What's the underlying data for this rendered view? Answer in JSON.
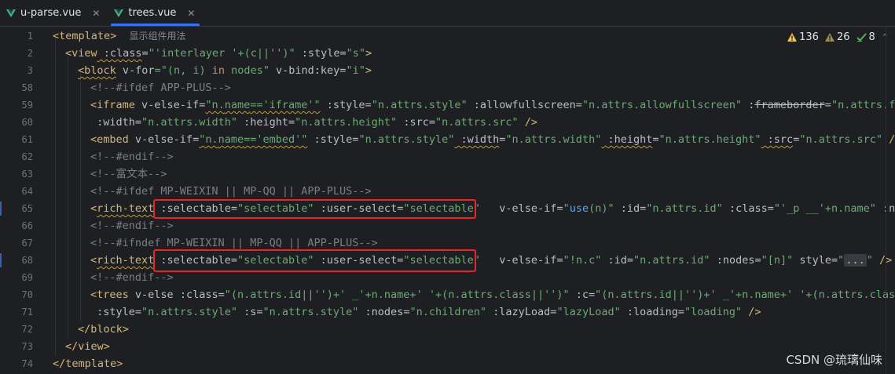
{
  "tabs": [
    {
      "label": "u-parse.vue",
      "active": false
    },
    {
      "label": "trees.vue",
      "active": true
    }
  ],
  "inspections": {
    "warnings": "136",
    "weak_warnings": "26",
    "ok": "8"
  },
  "inlay_hint": "显示组件用法",
  "line_numbers": [
    "1",
    "2",
    "3",
    "58",
    "59",
    "60",
    "61",
    "62",
    "63",
    "64",
    "65",
    "66",
    "67",
    "68",
    "69",
    "70",
    "71",
    "72",
    "73",
    "74"
  ],
  "code": {
    "l1_tag": "<template>",
    "l2_a": "<view",
    "l2_b": " :class",
    "l2_c": "=",
    "l2_d": "\"'interlayer '+(c||'')\"",
    "l2_e": " :style",
    "l2_f": "=",
    "l2_g": "\"s\"",
    "l2_h": ">",
    "l3_a": "<block",
    "l3_b": " v-for",
    "l3_c": "=\"(n, i) ",
    "l3_d": "in",
    "l3_e": " nodes\"",
    "l3_f": " v-bind:key",
    "l3_g": "=",
    "l3_h": "\"i\"",
    "l3_i": ">",
    "l58": "<!--#ifdef APP-PLUS-->",
    "l59_a": "<iframe",
    "l59_b": " v-else-if",
    "l59_c": "=",
    "l59_d": "\"n.",
    "l59_e": "name",
    "l59_f": "=='iframe'\"",
    "l59_g": " :style",
    "l59_h": "=",
    "l59_i": "\"n.attrs.style\"",
    "l59_j": " :allowfullscreen",
    "l59_k": "=",
    "l59_l": "\"n.attrs.allowfullscreen\"",
    "l59_m": " :",
    "l59_n": "frameborder",
    "l59_o": "=",
    "l59_p": "\"n.attrs.fra",
    "l60_a": " :width",
    "l60_b": "=",
    "l60_c": "\"n.attrs.width\"",
    "l60_d": " :height",
    "l60_e": "=",
    "l60_f": "\"n.attrs.height\"",
    "l60_g": " :src",
    "l60_h": "=",
    "l60_i": "\"n.attrs.src\"",
    "l60_j": " />",
    "l61_a": "<embed",
    "l61_b": " v-else-if",
    "l61_c": "=",
    "l61_d": "\"n.",
    "l61_e": "name",
    "l61_f": "=='embed'\"",
    "l61_g": " :style",
    "l61_h": "=",
    "l61_i": "\"n.attrs.style\"",
    "l61_j": " :width",
    "l61_k": "=",
    "l61_l": "\"n.attrs.width\"",
    "l61_m": " :height",
    "l61_n": "=",
    "l61_o": "\"n.attrs.height\"",
    "l61_p": " :src",
    "l61_q": "=",
    "l61_r": "\"n.attrs.src\"",
    "l61_s": " />",
    "l62": "<!--#endif-->",
    "l63": "<!--富文本-->",
    "l64": "<!--#ifdef MP-WEIXIN || MP-QQ || APP-PLUS-->",
    "l65_a": "<",
    "l65_b": "rich-text",
    "l65_c": " :selectable",
    "l65_d": "=",
    "l65_e": "\"selectable\"",
    "l65_f": " :user-select",
    "l65_g": "=",
    "l65_h": "\"selectable\"",
    "l65_i": " v-else-if",
    "l65_j": "=",
    "l65_k": "\"",
    "l65_l": "use",
    "l65_m": "(n)\"",
    "l65_n": " :id",
    "l65_o": "=",
    "l65_p": "\"n.attrs.id\"",
    "l65_q": " :class",
    "l65_r": "=",
    "l65_s": "\"'_p __'+n.name\"",
    "l65_t": " :nodes",
    "l66": "<!--#endif-->",
    "l67": "<!--#ifndef MP-WEIXIN || MP-QQ || APP-PLUS-->",
    "l68_a": "<",
    "l68_b": "rich-text",
    "l68_c": " :selectable",
    "l68_d": "=",
    "l68_e": "\"selectable\"",
    "l68_f": " :user-select",
    "l68_g": "=",
    "l68_h": "\"selectable\"",
    "l68_i": " v-else-if",
    "l68_j": "=",
    "l68_k": "\"!n.c\"",
    "l68_l": " :id",
    "l68_m": "=",
    "l68_n": "\"n.attrs.id\"",
    "l68_o": " :nodes",
    "l68_p": "=",
    "l68_q": "\"[n]\"",
    "l68_r": " style",
    "l68_s": "=",
    "l68_t": "\"",
    "l68_u": "...",
    "l68_v": "\"",
    "l68_w": " />",
    "l69": "<!--#endif-->",
    "l70_a": "<trees",
    "l70_b": " v-else",
    "l70_c": " :class",
    "l70_d": "=",
    "l70_e": "\"(n.attrs.id||'')+' _'+n.name+' '+(n.attrs.class||'')\"",
    "l70_f": " :c",
    "l70_g": "=",
    "l70_h": "\"(n.attrs.id||'')+' _'+n.name+' '+(n.attrs.class|",
    "l71_a": " :style",
    "l71_b": "=",
    "l71_c": "\"n.attrs.style\"",
    "l71_d": " :s",
    "l71_e": "=",
    "l71_f": "\"n.attrs.style\"",
    "l71_g": " :nodes",
    "l71_h": "=",
    "l71_i": "\"n.children\"",
    "l71_j": " :lazyLoad",
    "l71_k": "=",
    "l71_l": "\"lazyLoad\"",
    "l71_m": " :loading",
    "l71_n": "=",
    "l71_o": "\"loading\"",
    "l71_p": " />",
    "l72": "</block>",
    "l73": "</view>",
    "l74": "</template>"
  },
  "watermark": "CSDN @琉璃仙味",
  "colors": {
    "background": "#1e1f22",
    "tag": "#d5b778",
    "string": "#6aab73",
    "comment": "#7a7e85",
    "keyword": "#cf8e6d",
    "highlight_box": "#e8262a",
    "active_tab": "#3574f0"
  }
}
